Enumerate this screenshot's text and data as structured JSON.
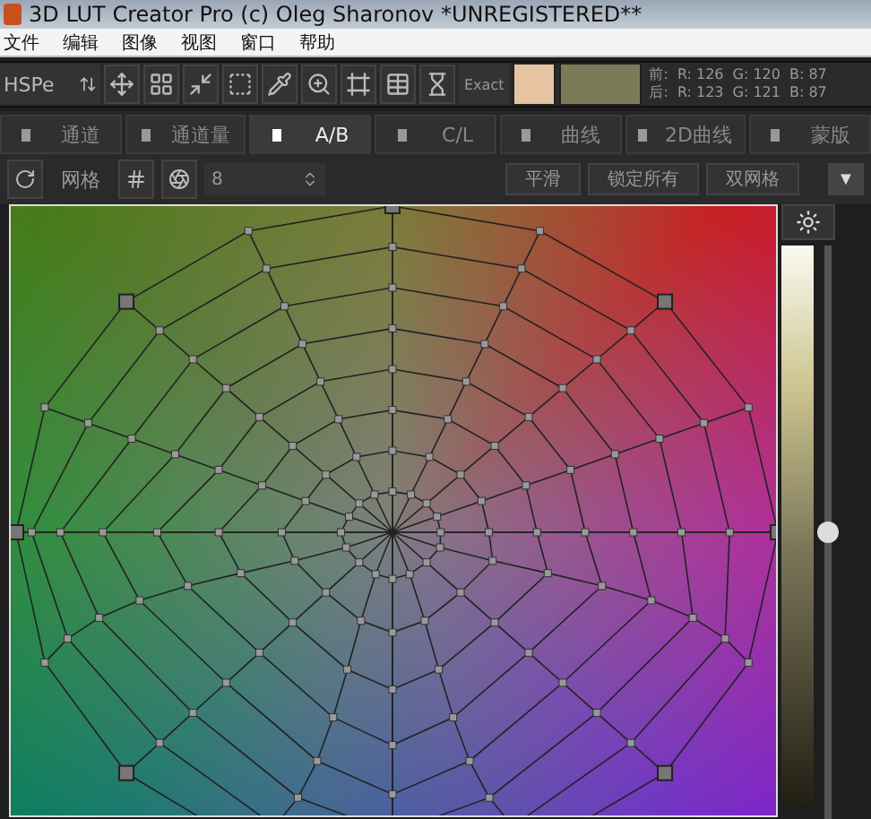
{
  "window": {
    "title": "3D LUT Creator Pro (c) Oleg Sharonov *UNREGISTERED**"
  },
  "menu": [
    "文件",
    "编辑",
    "图像",
    "视图",
    "窗口",
    "帮助"
  ],
  "toolbar": {
    "mode": "HSPe",
    "exact": "Exact",
    "swatches": [
      {
        "color": "#e6c4a2"
      },
      {
        "color": "#7c7b58"
      }
    ],
    "readings": [
      {
        "label": "前:",
        "r": "R: 126",
        "g": "G: 120",
        "b": "B: 87"
      },
      {
        "label": "后:",
        "r": "R: 123",
        "g": "G: 121",
        "b": "B: 87"
      }
    ]
  },
  "tabs": [
    {
      "label": "通道",
      "selected": false
    },
    {
      "label": "通道量",
      "selected": false
    },
    {
      "label": "A/B",
      "selected": true
    },
    {
      "label": "C/L",
      "selected": false
    },
    {
      "label": "曲线",
      "selected": false
    },
    {
      "label": "2D曲线",
      "selected": false
    },
    {
      "label": "蒙版",
      "selected": false
    }
  ],
  "grid": {
    "label": "网格",
    "value": "8",
    "buttons": [
      "平滑",
      "锁定所有",
      "双网格"
    ],
    "more": "▼"
  },
  "brightness": {
    "level": 0.5
  }
}
